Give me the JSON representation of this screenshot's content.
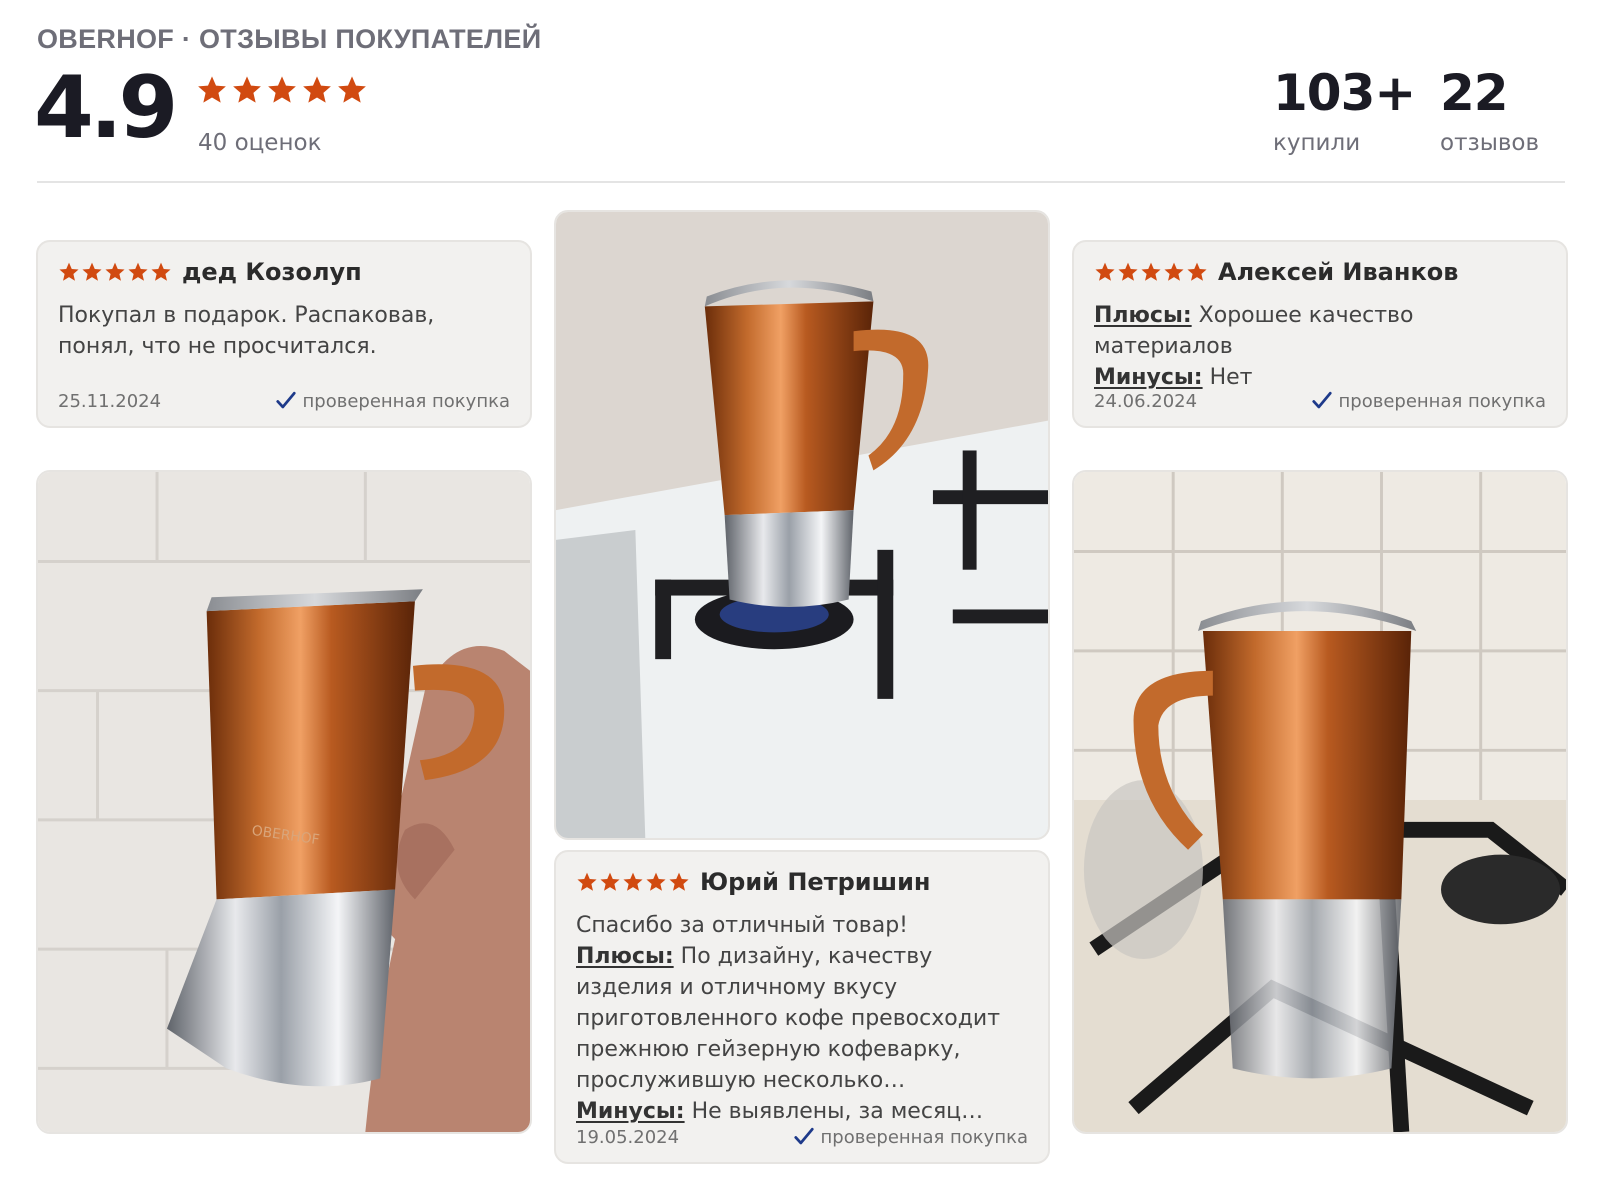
{
  "header": {
    "brand_title": "OBERHOF · ОТЗЫВЫ ПОКУПАТЕЛЕЙ",
    "rating": "4.9",
    "stars": 5,
    "ratings_count": "40 оценок",
    "stats": [
      {
        "value": "103+",
        "label": "купили"
      },
      {
        "value": "22",
        "label": "отзывов"
      }
    ]
  },
  "colors": {
    "star": "#d14a10",
    "check": "#1e3a8a",
    "card_bg": "#f2f1ef",
    "copper": "#c0672a"
  },
  "reviews": [
    {
      "author": "дед Козолуп",
      "stars": 5,
      "text": "Покупал в подарок. Распаковав, понял, что не просчитался.",
      "date": "25.11.2024",
      "verified": "проверенная покупка"
    },
    {
      "author": "Алексей Иванков",
      "stars": 5,
      "pros_label": "Плюсы:",
      "pros": "Хорошее качество материалов",
      "cons_label": "Минусы:",
      "cons": "Нет",
      "date": "24.06.2024",
      "verified": "проверенная покупка"
    },
    {
      "author": "Юрий Петришин",
      "stars": 5,
      "text": "Спасибо за отличный товар!",
      "pros_label": "Плюсы:",
      "pros": "По дизайну, качеству изделия и отличному вкусу приготовленного кофе превосходит прежнюю гейзерную кофеварку, прослужившую несколько…",
      "cons_label": "Минусы:",
      "cons": "Не выявлены, за месяц…",
      "date": "19.05.2024",
      "verified": "проверенная покупка"
    }
  ],
  "photos": [
    {
      "name": "photo-coffee-maker-in-hand"
    },
    {
      "name": "photo-coffee-maker-on-stove-white"
    },
    {
      "name": "photo-coffee-maker-on-stove-tiles"
    }
  ]
}
